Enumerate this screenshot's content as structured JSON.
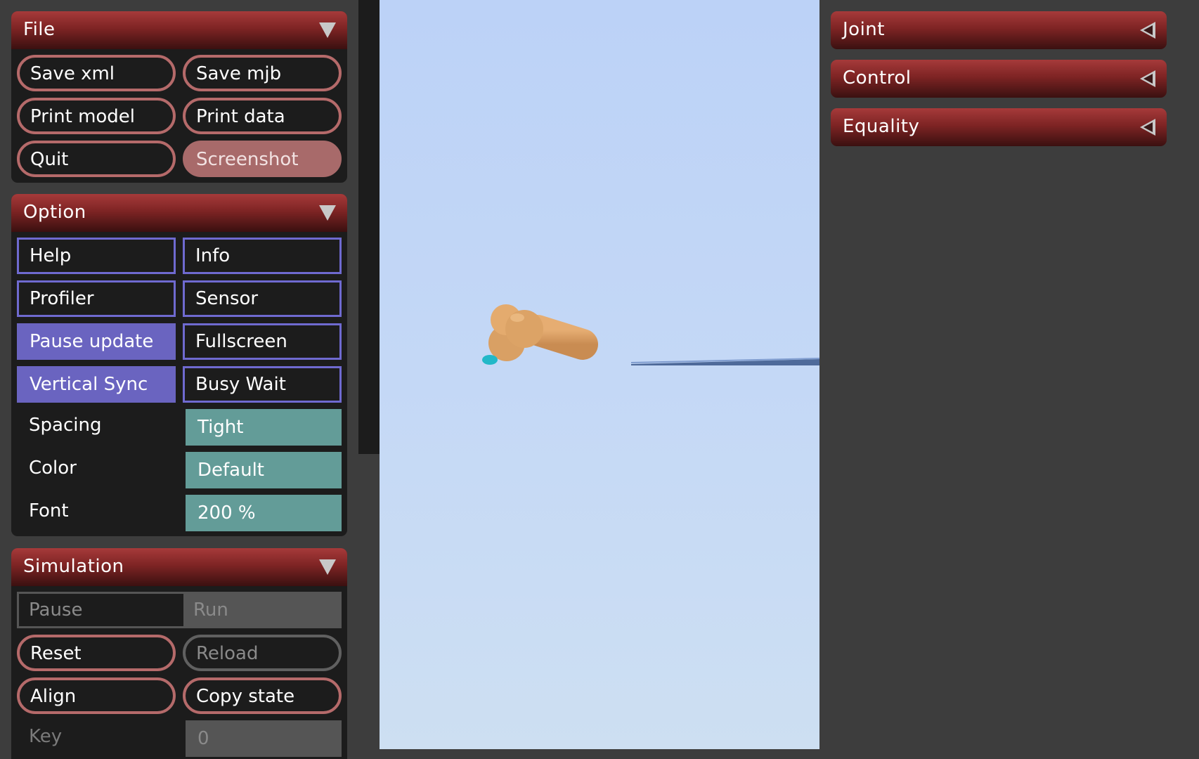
{
  "file_panel": {
    "title": "File",
    "buttons": [
      "Save xml",
      "Save mjb",
      "Print model",
      "Print data",
      "Quit",
      "Screenshot"
    ]
  },
  "option_panel": {
    "title": "Option",
    "toggles": [
      "Help",
      "Info",
      "Profiler",
      "Sensor",
      "Pause update",
      "Fullscreen",
      "Vertical Sync",
      "Busy Wait"
    ],
    "active_toggles": [
      "Pause update",
      "Vertical Sync"
    ],
    "spacing": {
      "label": "Spacing",
      "value": "Tight"
    },
    "color": {
      "label": "Color",
      "value": "Default"
    },
    "font": {
      "label": "Font",
      "value": "200 %"
    }
  },
  "simulation_panel": {
    "title": "Simulation",
    "run_mode": [
      "Pause",
      "Run"
    ],
    "buttons": [
      "Reset",
      "Reload",
      "Align",
      "Copy state"
    ],
    "key": {
      "label": "Key",
      "value": "0"
    }
  },
  "right_panels": [
    "Joint",
    "Control",
    "Equality"
  ],
  "colors": {
    "panel_header": "#7e2424",
    "pill_border": "#b56a6a",
    "toggle_active": "#6a64c0",
    "select_teal": "#639c98",
    "sky": "#c4d8f6",
    "body": "#d4985e",
    "marker": "#22b8c8"
  }
}
